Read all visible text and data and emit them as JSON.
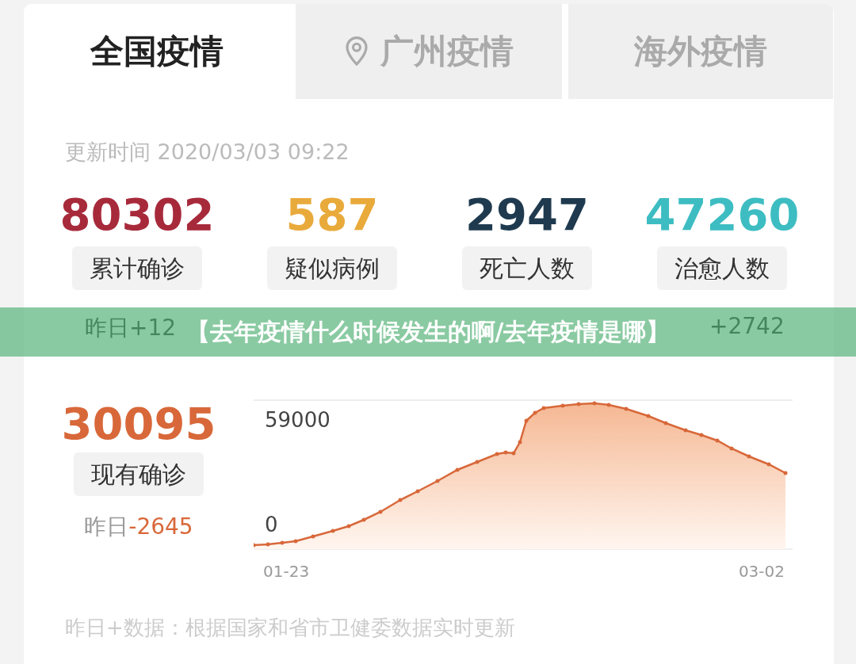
{
  "tabs": [
    {
      "label": "全国疫情",
      "selected": true,
      "kind": "plain"
    },
    {
      "label": "广州疫情",
      "selected": false,
      "kind": "location"
    },
    {
      "label": "海外疫情",
      "selected": false,
      "kind": "plain"
    }
  ],
  "update_time": "更新时间 2020/03/03 09:22",
  "stats": [
    {
      "value": "80302",
      "label": "累计确诊",
      "color": "#a72a3b"
    },
    {
      "value": "587",
      "label": "疑似病例",
      "color": "#e9aa3c"
    },
    {
      "value": "2947",
      "label": "死亡人数",
      "color": "#1f3a4f"
    },
    {
      "value": "47260",
      "label": "治愈人数",
      "color": "#3dbdc2"
    }
  ],
  "yesterday_row": [
    "昨日+12",
    "+2742"
  ],
  "banner": "【去年疫情什么时候发生的啊/去年疫情是哪】",
  "current": {
    "value": "30095",
    "label": "现有确诊",
    "yesterday_prefix": "昨日",
    "yesterday_change": "-2645",
    "color": "#d8683a"
  },
  "trend_chart": {
    "y_max_label": "59000",
    "y_min_label": "0",
    "x_start": "01-23",
    "x_end": "03-02"
  },
  "footnote": "昨日+数据：根据国家和省市卫健委数据实时更新"
}
